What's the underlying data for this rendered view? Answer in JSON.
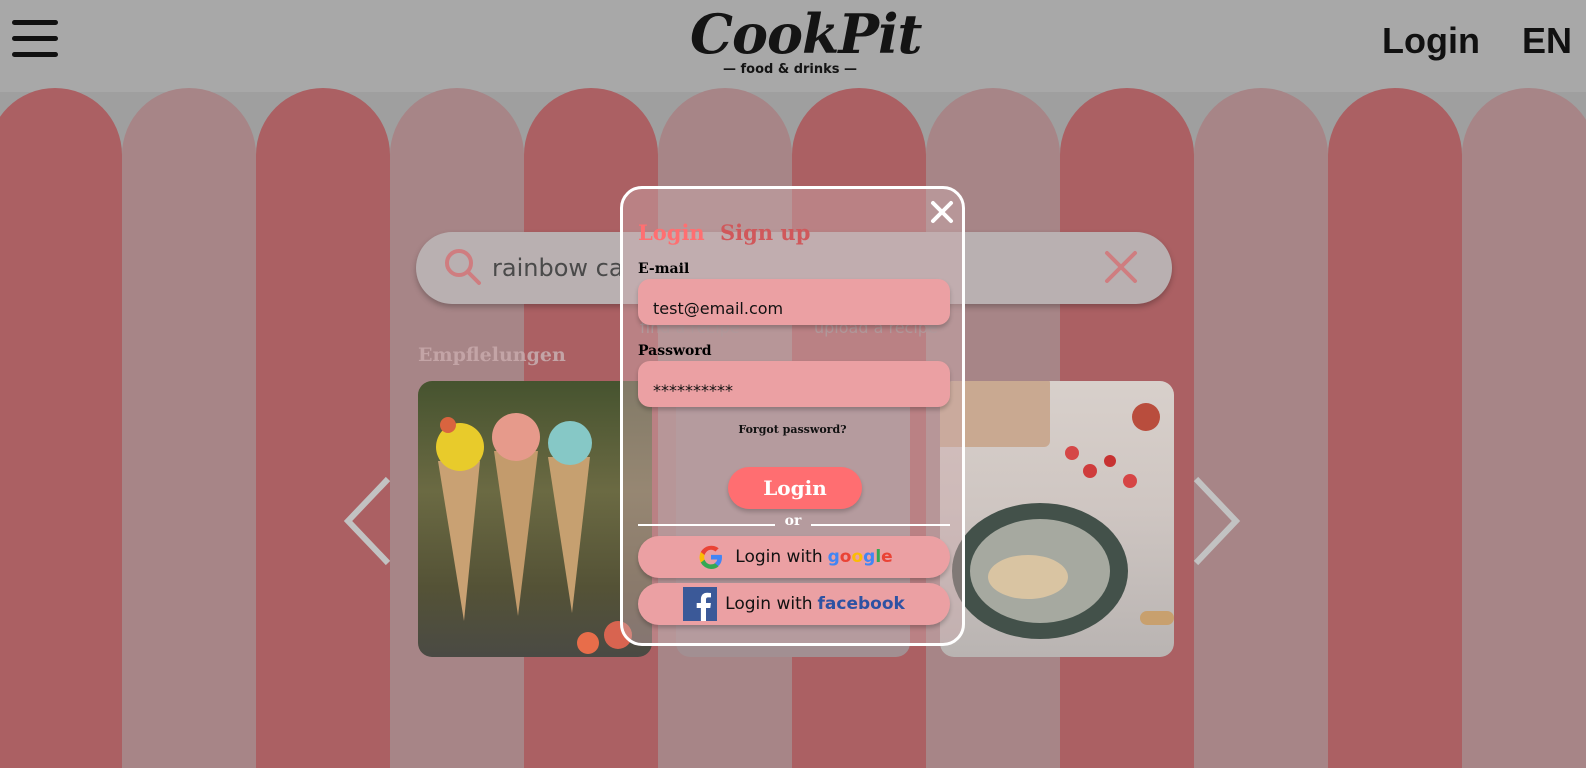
{
  "header": {
    "logo_title": "CookPit",
    "logo_subtitle": "— food & drinks —",
    "login_label": "Login",
    "language_label": "EN"
  },
  "search": {
    "value": "rainbow ca"
  },
  "background_tabs": [
    "find a recipe",
    "upload a recipe"
  ],
  "recommendations": {
    "title": "Empflelungen"
  },
  "modal": {
    "tabs": {
      "login": "Login",
      "signup": "Sign up"
    },
    "email": {
      "label": "E-mail",
      "value": "test@email.com"
    },
    "password": {
      "label": "Password",
      "value": "**********"
    },
    "forgot_label": "Forgot password?",
    "submit_label": "Login",
    "divider_label": "or",
    "google": {
      "prefix": "Login with",
      "brand_letters": [
        "g",
        "o",
        "o",
        "g",
        "l",
        "e"
      ],
      "brand_colors": [
        "#4285f4",
        "#ea4335",
        "#fbbc05",
        "#4285f4",
        "#34a853",
        "#ea4335"
      ]
    },
    "facebook": {
      "prefix": "Login with",
      "brand": "facebook"
    }
  },
  "colors": {
    "accent": "#ff6e71",
    "input_bg": "#eba0a3",
    "awning_dark": "#ab6063",
    "awning_light": "#a78587"
  }
}
